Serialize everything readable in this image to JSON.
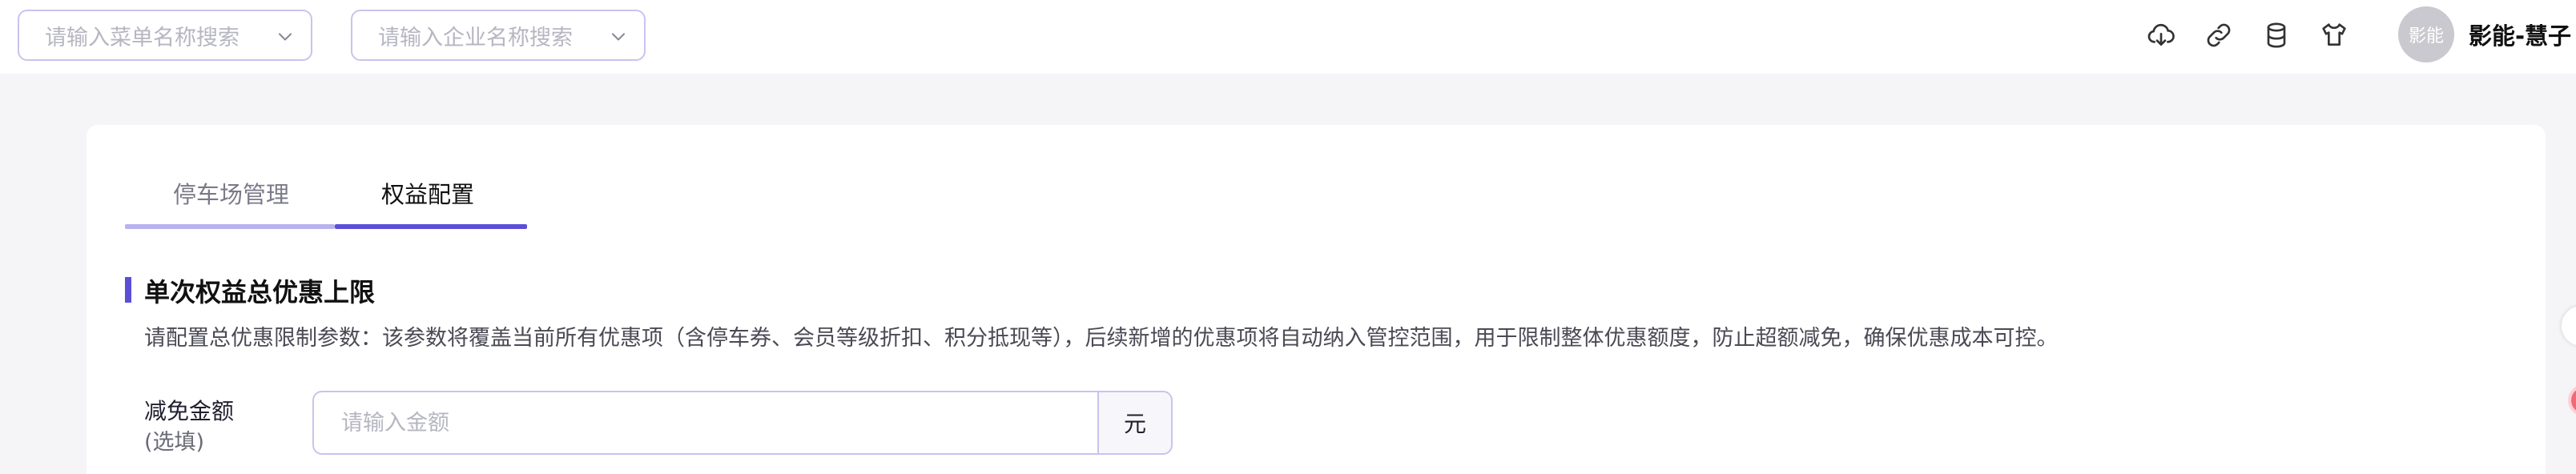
{
  "header": {
    "menu_search": {
      "placeholder": "请输入菜单名称搜索"
    },
    "company_search": {
      "placeholder": "请输入企业名称搜索"
    },
    "icons": [
      "cloud-download-icon",
      "link-icon",
      "database-icon",
      "shirt-icon"
    ],
    "avatar_text": "影能",
    "username": "影能-慧子"
  },
  "tabs": [
    {
      "label": "停车场管理",
      "active": false
    },
    {
      "label": "权益配置",
      "active": true
    }
  ],
  "section": {
    "title": "单次权益总优惠上限",
    "description": "请配置总优惠限制参数：该参数将覆盖当前所有优惠项（含停车券、会员等级折扣、积分抵现等），后续新增的优惠项将自动纳入管控范围，用于限制整体优惠额度，防止超额减免，确保优惠成本可控。"
  },
  "form": {
    "amount_label": "减免金额",
    "amount_sublabel": "(选填)",
    "amount_placeholder": "请输入金额",
    "amount_value": "",
    "amount_unit": "元"
  },
  "colors": {
    "accent": "#5b4fd8",
    "accent_light": "#b9b2ee",
    "border": "#c9c3ee",
    "background": "#f5f5f8"
  }
}
